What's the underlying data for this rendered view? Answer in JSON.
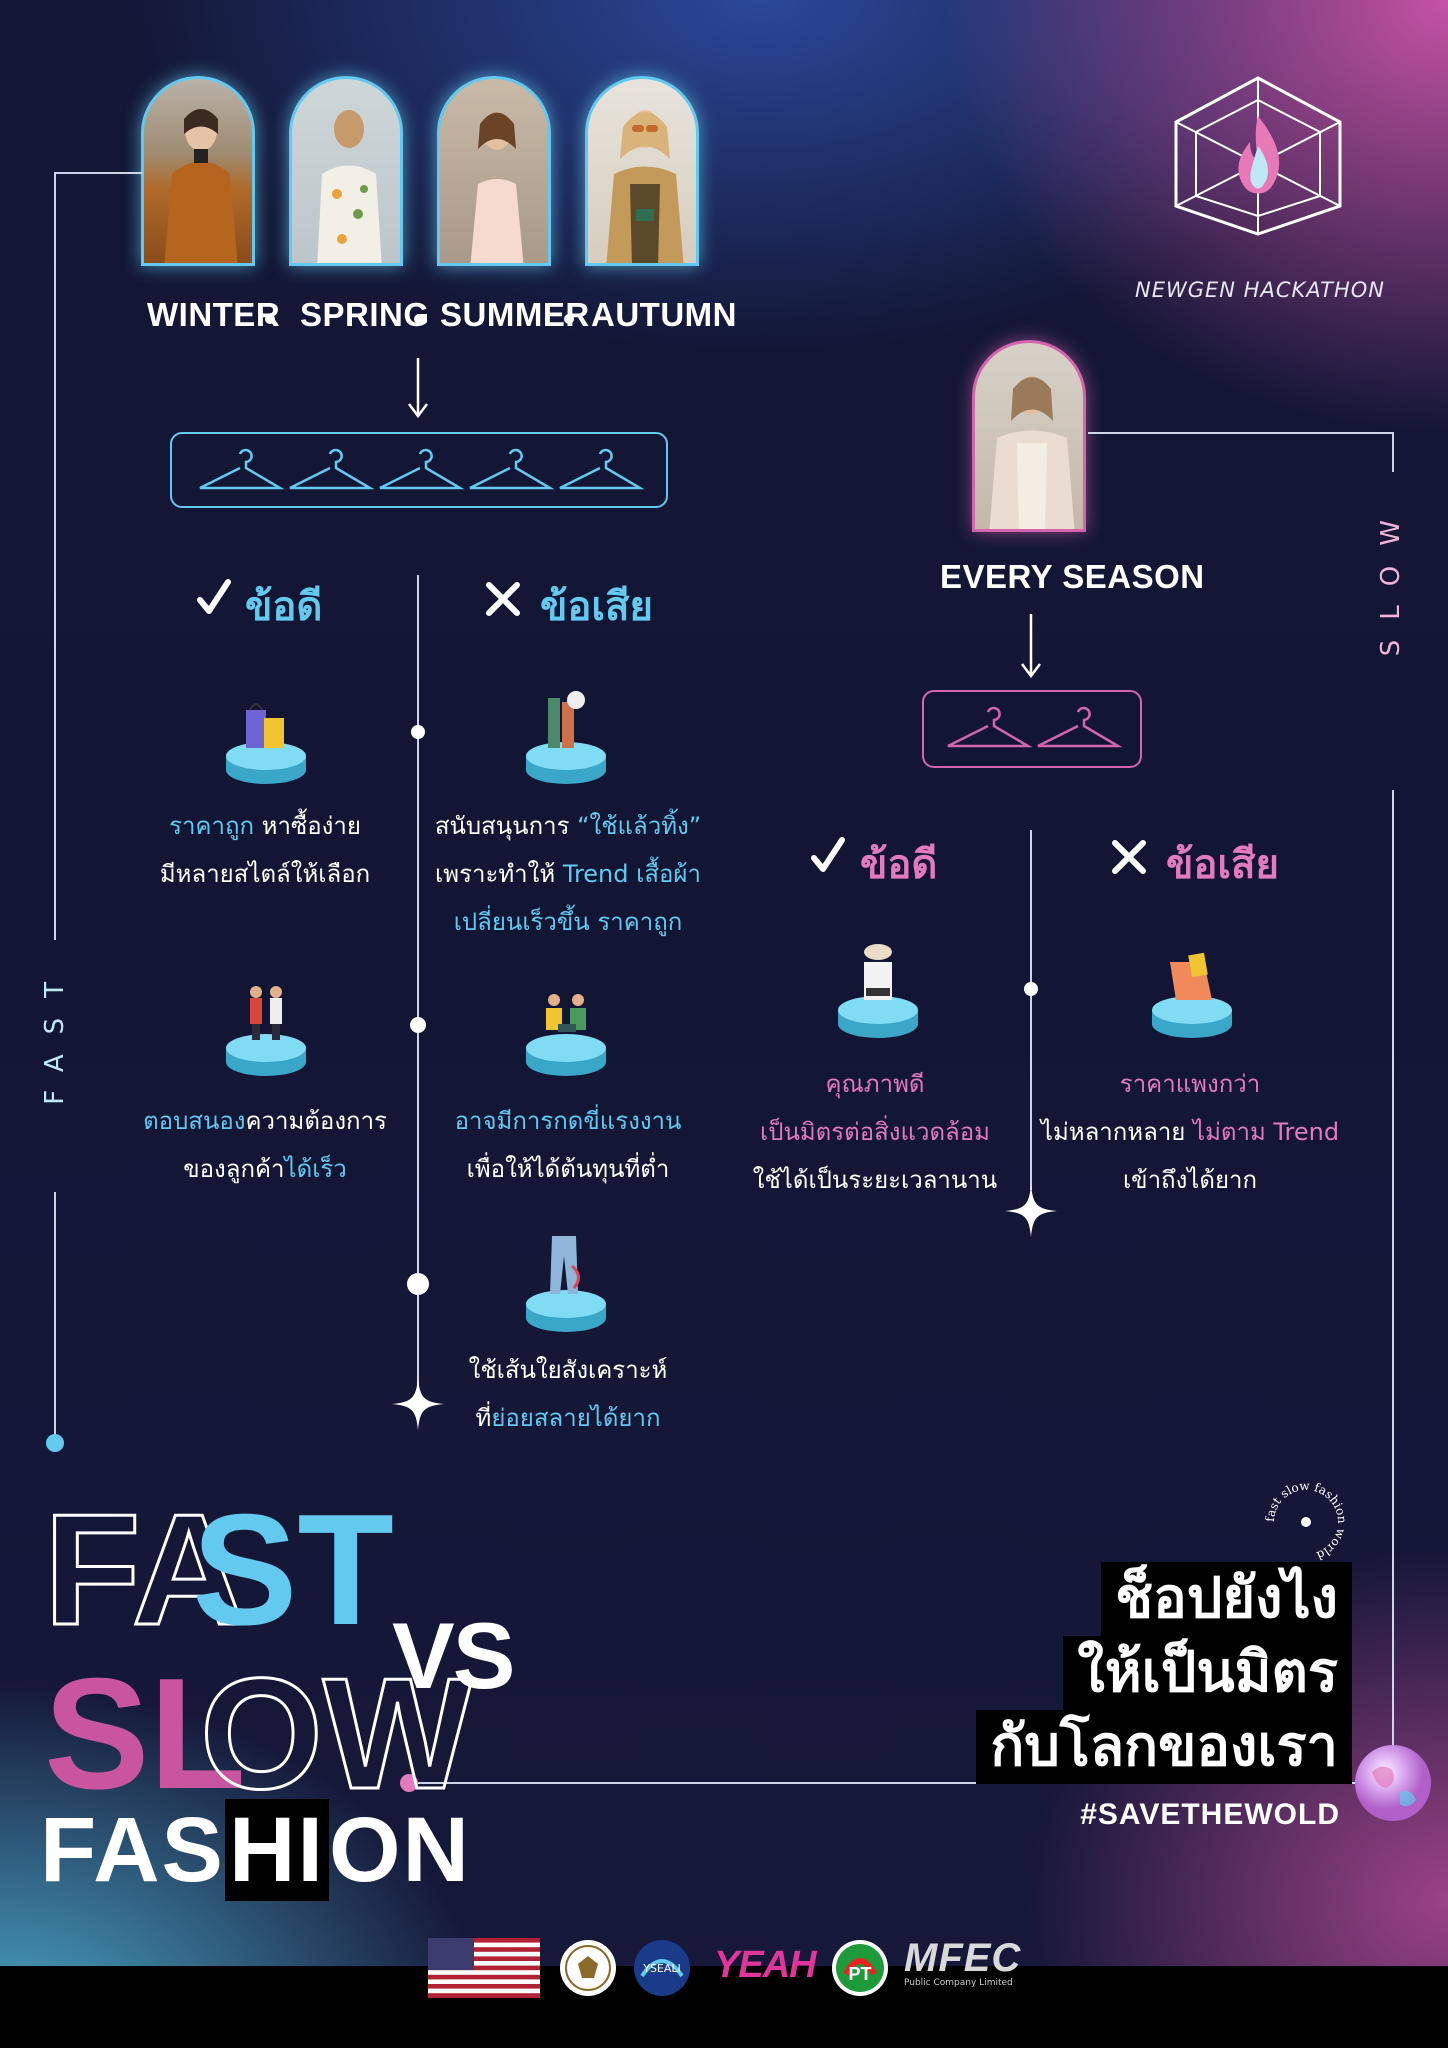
{
  "fast": {
    "seasons": [
      "WINTER",
      "SPRING",
      "SUMMER",
      "AUTUMN"
    ],
    "side_label": "FAST",
    "pros_title": "ข้อดี",
    "cons_title": "ข้อเสีย",
    "pros": [
      {
        "hl": "ราคาถูก",
        "rest": "หาซื้อง่าย",
        "line2": "มีหลายสไตล์ให้เลือก"
      },
      {
        "hl": "ตอบสนอง",
        "rest": "ความต้องการ",
        "line2a": "ของลูกค้า",
        "line2b": "ได้เร็ว"
      }
    ],
    "cons": [
      {
        "l1a": "สนับสนุนการ",
        "l1b": "“ใช้แล้วทิ้ง”",
        "l2a": "เพราะทำให้",
        "l2b": "Trend เสื้อผ้า",
        "l3": "เปลี่ยนเร็วขึ้น ราคาถูก"
      },
      {
        "l1": "อาจมีการกดขี่แรงงาน",
        "l2": "เพื่อให้ได้ต้นทุนที่ต่ำ"
      },
      {
        "l1": "ใช้เส้นใยสังเคราะห์",
        "l2a": "ที่",
        "l2b": "ย่อยสลายได้ยาก"
      }
    ]
  },
  "slow": {
    "season": "EVERY SEASON",
    "side_label": "SLOW",
    "pros_title": "ข้อดี",
    "cons_title": "ข้อเสีย",
    "pros": {
      "l1": "คุณภาพดี",
      "l2": "เป็นมิตรต่อสิ่งแวดล้อม",
      "l3": "ใช้ได้เป็นระยะเวลานาน"
    },
    "cons": {
      "l1": "ราคาแพงกว่า",
      "l2a": "ไม่หลากหลาย",
      "l2b": "ไม่ตาม Trend",
      "l3": "เข้าถึงได้ยาก"
    }
  },
  "brand": {
    "name": "NEWGEN HACKATHON"
  },
  "title": {
    "fast_outline": "FA",
    "fast_fill": "ST",
    "vs": "VS",
    "slow_fill": "SL",
    "slow_outline": "OW",
    "fashion_a": "FAS",
    "fashion_b": "HI",
    "fashion_c": "ON"
  },
  "cta": {
    "line1": "ช็อปยังไง",
    "line2": "ให้เป็นมิตร",
    "line3": "กับโลกของเรา",
    "hashtag": "#SAVETHEWOLD",
    "stamp": "fast slow fashion world"
  },
  "footer": {
    "logo_yeah": "YEAH",
    "logo_yseali": "YSEALI",
    "logo_mfec": "MFEC",
    "mfec_sub": "Public Company Limited"
  },
  "colors": {
    "blue": "#63c9ee",
    "pink": "#e27abd",
    "dark": "#141736"
  }
}
